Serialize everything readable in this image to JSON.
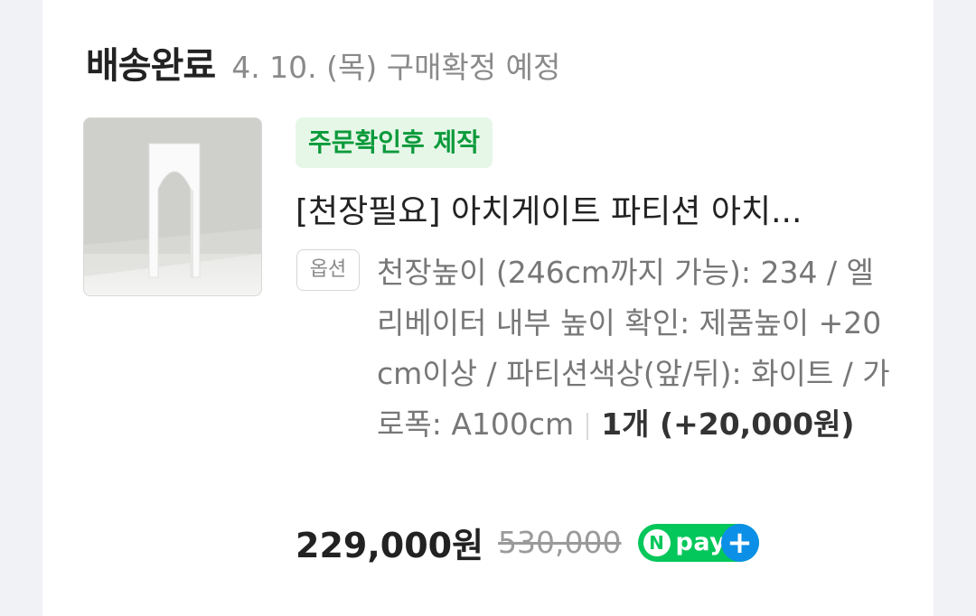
{
  "order": {
    "status": "배송완료",
    "confirm_date_text": "4. 10. (목) 구매확정 예정"
  },
  "product": {
    "image_icon": "arch-gate-product-image",
    "badge": "주문확인후 제작",
    "title": "[천장필요] 아치게이트 파티션 아치...",
    "option_label": "옵션",
    "option_text": "천장높이 (246cm까지 가능): 234 / 엘리베이터 내부 높이 확인: 제품높이 +20cm이상 / 파티션색상(앞/뒤): 화이트 / 가로폭: A100cm",
    "quantity": "1개 (+20,000원)",
    "price": "229,000원",
    "original_price": "530,000"
  },
  "npay": {
    "n": "N",
    "word": "pay",
    "plus": "+",
    "brand_color": "#03c75a",
    "plus_color": "#0c8fe6"
  },
  "colors": {
    "badge_bg": "#e6f7e8",
    "badge_text": "#0c9a3b"
  }
}
